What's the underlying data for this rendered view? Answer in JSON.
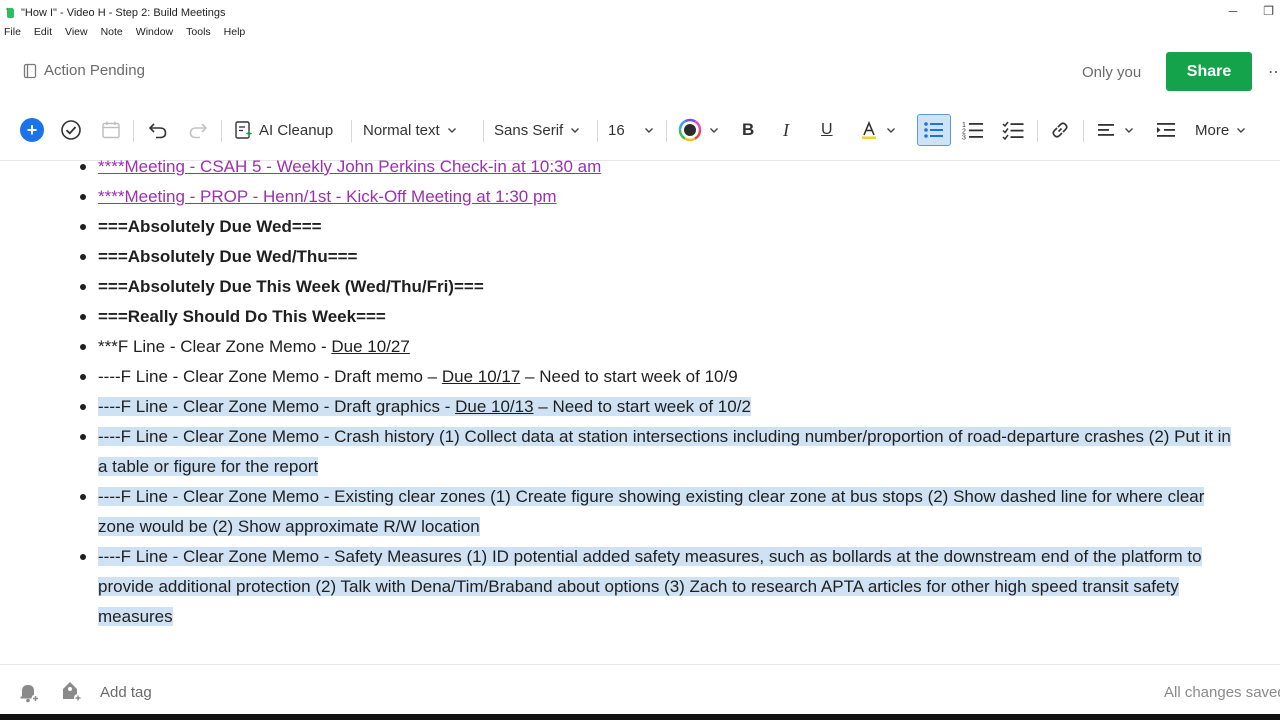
{
  "window": {
    "title": "\"How I\" - Video H - Step 2: Build Meetings",
    "minimize": "─",
    "restore": "❐"
  },
  "menu": [
    "File",
    "Edit",
    "View",
    "Note",
    "Window",
    "Tools",
    "Help"
  ],
  "header": {
    "status": "Action Pending",
    "visibility": "Only you",
    "share_label": "Share",
    "more": "⋯"
  },
  "toolbar": {
    "ai_cleanup": "AI Cleanup",
    "text_style": "Normal text",
    "font": "Sans Serif",
    "font_size": "16",
    "bold": "B",
    "italic": "I",
    "underline": "U",
    "more": "More"
  },
  "colors": {
    "share_green": "#14a34a",
    "accent_blue": "#1a73e8",
    "link_purple": "#9b30b0",
    "selection": "#cfe2f3"
  },
  "note": {
    "items": {
      "i0": {
        "text": "****Meeting - CSAH 5 - Weekly John Perkins Check-in at 10:30 am"
      },
      "i1": {
        "text": "****Meeting - PROP - Henn/1st - Kick-Off Meeting at 1:30 pm"
      },
      "i2": {
        "text": "===Absolutely Due Wed==="
      },
      "i3": {
        "text": "===Absolutely Due Wed/Thu==="
      },
      "i4": {
        "text": "===Absolutely Due This Week (Wed/Thu/Fri)==="
      },
      "i5": {
        "text": "===Really Should Do This Week==="
      },
      "i6": {
        "pre": "***F Line - Clear Zone Memo - ",
        "due": "Due 10/27"
      },
      "i7": {
        "pre": "----F Line - Clear Zone Memo - Draft memo – ",
        "due": "Due 10/17",
        "post": " – Need to start week of 10/9"
      },
      "i8": {
        "pre": "----F Line - Clear Zone Memo - Draft graphics - ",
        "due": "Due 10/13",
        "post": "  – Need to start week of 10/2"
      },
      "i9": {
        "text": "----F Line - Clear Zone Memo - Crash history (1) Collect data at station intersections including number/proportion of road-departure crashes (2) Put it in a table or figure for the report"
      },
      "i10": {
        "text": "----F Line - Clear Zone Memo - Existing clear zones (1) Create figure showing existing clear zone at bus stops (2) Show dashed line for where clear zone would be (2) Show approximate R/W location"
      },
      "i11": {
        "text": "----F Line - Clear Zone Memo - Safety Measures (1) ID potential added safety measures, such as bollards at the downstream end of the platform to provide additional protection (2) Talk with Dena/Tim/Braband about options (3) Zach to research APTA articles for other high speed transit safety measures"
      }
    }
  },
  "footer": {
    "add_tag": "Add tag",
    "saved": "All changes saved"
  }
}
